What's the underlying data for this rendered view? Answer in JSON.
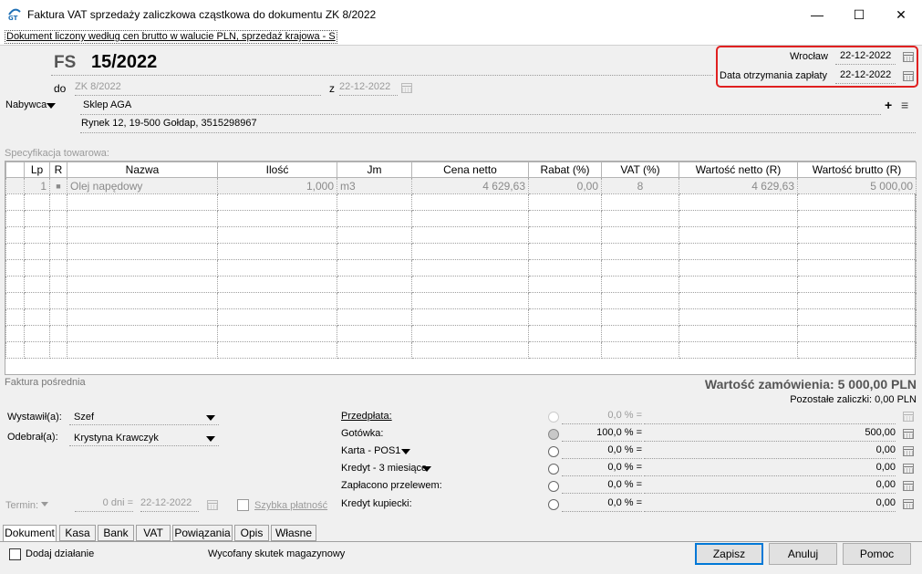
{
  "window": {
    "title": "Faktura VAT sprzedaży zaliczkowa cząstkowa do dokumentu ZK 8/2022",
    "minimize": "—",
    "maximize": "☐",
    "close": "✕"
  },
  "banner": "Dokument liczony według cen brutto w walucie PLN, sprzedaż krajowa - S",
  "header": {
    "doc_type": "FS",
    "doc_number": "15/2022",
    "do_label": "do",
    "do_value": "ZK 8/2022",
    "z_label": "z",
    "z_date": "22-12-2022",
    "place_label": "Wrocław",
    "place_date": "22-12-2022",
    "payment_label": "Data otrzymania zapłaty",
    "payment_date": "22-12-2022"
  },
  "buyer": {
    "label": "Nabywca",
    "name": "Sklep AGA",
    "address": "Rynek 12, 19-500 Gołdap, 3515298967",
    "add": "+",
    "list": "≡"
  },
  "spec_label": "Specyfikacja towarowa:",
  "table": {
    "columns": [
      "Lp",
      "R",
      "Nazwa",
      "Ilość",
      "Jm",
      "Cena netto",
      "Rabat (%)",
      "VAT (%)",
      "Wartość netto (R)",
      "Wartość brutto (R)"
    ],
    "rows": [
      [
        "1",
        "■",
        "Olej napędowy",
        "1,000",
        "m3",
        "4 629,63",
        "0,00",
        "8",
        "4 629,63",
        "5 000,00"
      ]
    ]
  },
  "summary": {
    "faktura_label": "Faktura pośrednia",
    "total_label": "Wartość zamówienia: 5 000,00 PLN",
    "remaining_label": "Pozostałe zaliczki: 0,00 PLN"
  },
  "people": {
    "issued_label": "Wystawił(a):",
    "issued_value": "Szef",
    "received_label": "Odebrał(a):",
    "received_value": "Krystyna Krawczyk"
  },
  "term": {
    "label": "Termin:",
    "days": "0 dni =",
    "date": "22-12-2022",
    "quick_label": "Szybka płatność"
  },
  "payments": [
    {
      "label": "Przedpłata:",
      "pct": "0,0 % =",
      "amount": "",
      "state": "dis"
    },
    {
      "label": "Gotówka:",
      "pct": "100,0 % =",
      "amount": "500,00",
      "state": "on"
    },
    {
      "label": "Karta - POS1",
      "pct": "0,0 % =",
      "amount": "0,00",
      "state": "off"
    },
    {
      "label": "Kredyt - 3 miesiące",
      "pct": "0,0 % =",
      "amount": "0,00",
      "state": "off"
    },
    {
      "label": "Zapłacono przelewem:",
      "pct": "0,0 % =",
      "amount": "0,00",
      "state": "off"
    },
    {
      "label": "Kredyt kupiecki:",
      "pct": "0,0 % =",
      "amount": "0,00",
      "state": "off"
    }
  ],
  "tabs": [
    "Dokument",
    "Kasa",
    "Bank",
    "VAT",
    "Powiązania",
    "Opis",
    "Własne"
  ],
  "footer": {
    "add_action": "Dodaj działanie",
    "status": "Wycofany skutek magazynowy",
    "save": "Zapisz",
    "cancel": "Anuluj",
    "help": "Pomoc"
  }
}
